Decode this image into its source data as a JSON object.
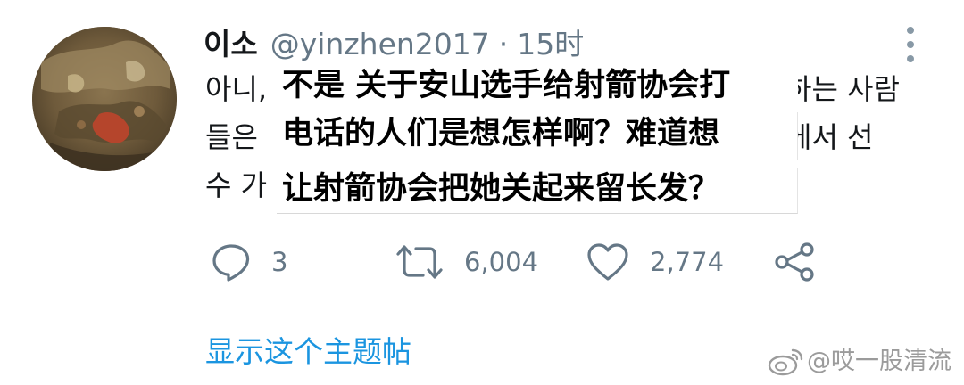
{
  "tweet": {
    "author": {
      "display_name": "이소",
      "handle": "@yinzhen2017",
      "separator": "·",
      "time": "15时"
    },
    "body_visible_fragments": {
      "line1_start": "아니,",
      "line1_end": "하는 사람",
      "line2_start": "들은",
      "line2_end": "에서 선",
      "line3_start": "수 가"
    },
    "translation_overlay": {
      "line1": "不是 关于安山选手给射箭协会打",
      "line2": "电话的人们是想怎样啊？难道想",
      "line3": "让射箭协会把她关起来留长发？"
    },
    "actions": {
      "reply": {
        "icon": "reply-icon",
        "count": "3"
      },
      "retweet": {
        "icon": "retweet-icon",
        "count": "6,004"
      },
      "like": {
        "icon": "heart-icon",
        "count": "2,774"
      },
      "share": {
        "icon": "share-icon"
      }
    },
    "show_thread_label": "显示这个主题帖"
  },
  "watermark": {
    "icon": "weibo-icon",
    "text": "@哎一股清流"
  },
  "colors": {
    "text_primary": "#14171a",
    "text_secondary": "#657786",
    "link": "#1b95e0",
    "background": "#ffffff"
  }
}
